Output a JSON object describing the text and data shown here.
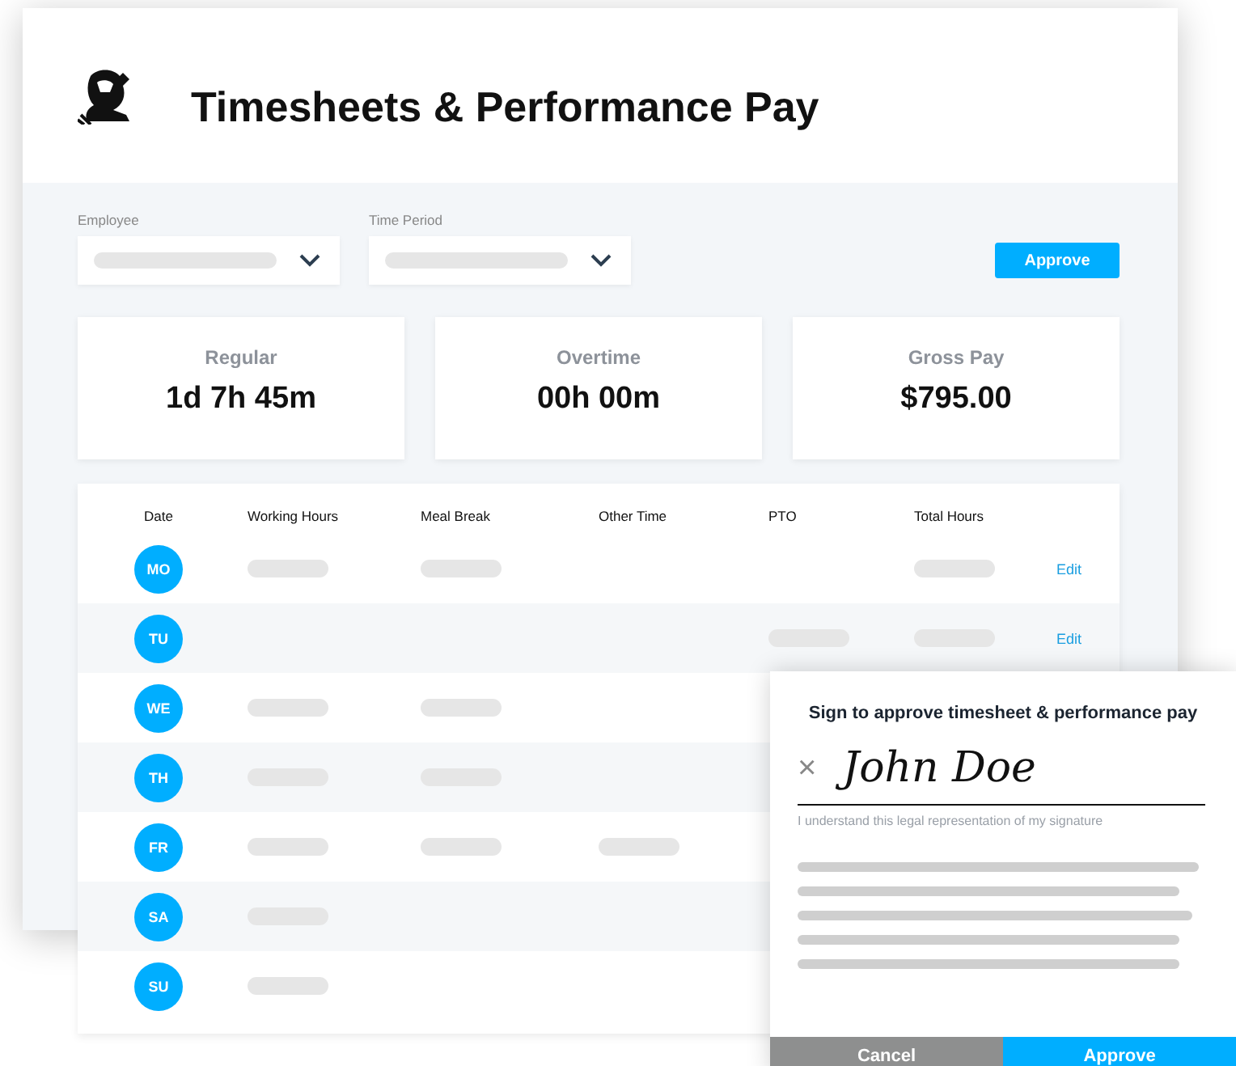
{
  "header": {
    "title": "Timesheets & Performance Pay"
  },
  "filters": [
    {
      "label": "Employee"
    },
    {
      "label": "Time Period"
    }
  ],
  "approve_button": "Approve",
  "stats": [
    {
      "label": "Regular",
      "value": "1d 7h 45m"
    },
    {
      "label": "Overtime",
      "value": "00h 00m"
    },
    {
      "label": "Gross Pay",
      "value": "$795.00"
    }
  ],
  "table": {
    "columns": [
      "Date",
      "Working Hours",
      "Meal Break",
      "Other Time",
      "PTO",
      "Total Hours"
    ],
    "rows": [
      {
        "day": "MO",
        "working_hours": true,
        "meal_break": true,
        "other_time": false,
        "pto": false,
        "total_hours": true,
        "edit": "Edit"
      },
      {
        "day": "TU",
        "working_hours": false,
        "meal_break": false,
        "other_time": false,
        "pto": true,
        "total_hours": true,
        "edit": "Edit"
      },
      {
        "day": "WE",
        "working_hours": true,
        "meal_break": true,
        "other_time": false,
        "pto": false,
        "total_hours": false
      },
      {
        "day": "TH",
        "working_hours": true,
        "meal_break": true,
        "other_time": false,
        "pto": false,
        "total_hours": false
      },
      {
        "day": "FR",
        "working_hours": true,
        "meal_break": true,
        "other_time": true,
        "pto": false,
        "total_hours": false
      },
      {
        "day": "SA",
        "working_hours": true,
        "meal_break": false,
        "other_time": false,
        "pto": false,
        "total_hours": false
      },
      {
        "day": "SU",
        "working_hours": true,
        "meal_break": false,
        "other_time": false,
        "pto": false,
        "total_hours": false
      }
    ]
  },
  "dialog": {
    "title": "Sign to approve timesheet & performance pay",
    "clear": "×",
    "signature": "John Doe",
    "caption": "I understand this legal representation of my signature",
    "buttons": [
      {
        "label": "Cancel",
        "kind": "secondary"
      },
      {
        "label": "Approve",
        "kind": "primary"
      }
    ]
  }
}
